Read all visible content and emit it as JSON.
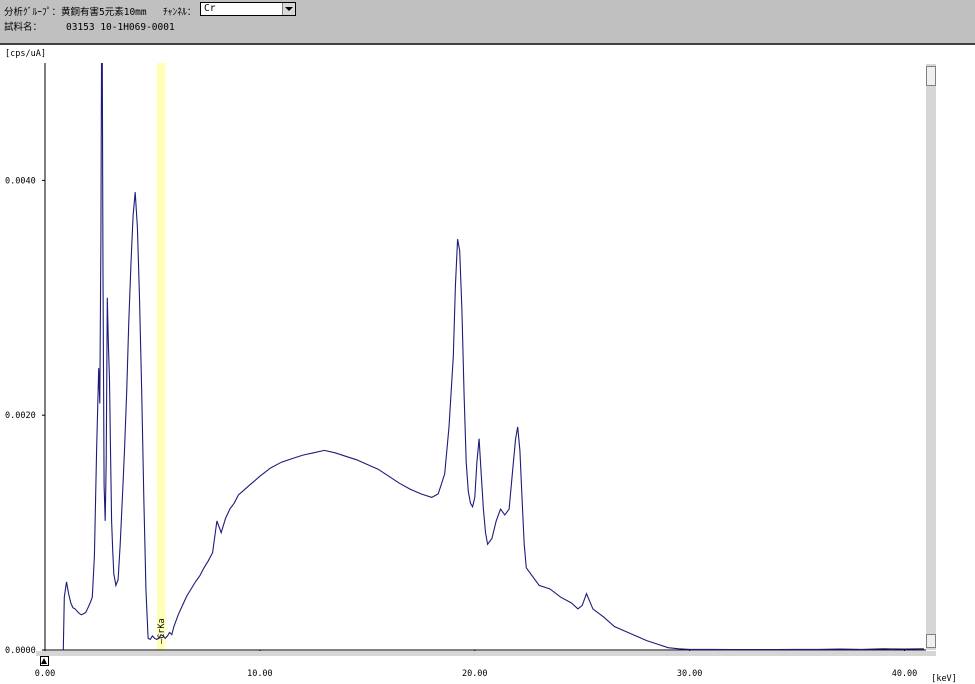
{
  "header": {
    "group_label": "分析ｸﾞﾙｰﾌﾟ：",
    "group_value": "黄銅有害5元素10mm",
    "channel_label": "ﾁｬﾝﾈﾙ：",
    "channel_value": "Cr",
    "sample_label": "試料名：",
    "sample_value": "03153 10-1H069-0001"
  },
  "colors": {
    "spectrum": "#1c1c7a",
    "highlight": "#ffffb8",
    "header_bg": "#c0c0c0",
    "scrollbar": "#d6d6d6"
  },
  "chart_data": {
    "type": "line",
    "xlabel": "[keV]",
    "ylabel": "[cps/uA]",
    "xlim": [
      0,
      41
    ],
    "ylim": [
      0,
      0.005
    ],
    "x_ticks": [
      "0.00",
      "10.00",
      "20.00",
      "30.00",
      "40.00"
    ],
    "y_ticks": [
      "0.0000",
      "0.0020",
      "0.0040"
    ],
    "x_tick_values": [
      0,
      10,
      20,
      30,
      40
    ],
    "y_tick_values": [
      0,
      0.002,
      0.004
    ],
    "grid": false,
    "highlight_band": {
      "label": "CrKa",
      "center": 5.41,
      "width": 0.4
    },
    "series": [
      {
        "x": [
          0.85,
          0.9,
          1.0,
          1.1,
          1.2,
          1.3,
          1.4,
          1.5,
          1.6,
          1.7,
          1.8,
          1.9,
          2.0,
          2.1,
          2.2,
          2.3,
          2.4,
          2.5,
          2.55,
          2.6,
          2.65,
          2.7,
          2.75,
          2.8,
          2.85,
          2.9,
          2.95,
          3.0,
          3.05,
          3.1,
          3.15,
          3.2,
          3.3,
          3.4,
          3.5,
          3.6,
          3.7,
          3.8,
          3.9,
          4.0,
          4.1,
          4.2,
          4.3,
          4.4,
          4.5,
          4.6,
          4.7,
          4.8,
          4.9,
          5.0,
          5.1,
          5.2,
          5.3,
          5.4,
          5.5,
          5.6,
          5.7,
          5.8,
          5.9,
          6.0,
          6.2,
          6.4,
          6.6,
          6.8,
          7.0,
          7.2,
          7.4,
          7.6,
          7.8,
          8.0,
          8.2,
          8.4,
          8.6,
          8.8,
          9.0,
          9.5,
          10.0,
          10.5,
          11.0,
          11.5,
          12.0,
          12.5,
          13.0,
          13.5,
          14.0,
          14.5,
          15.0,
          15.5,
          16.0,
          16.5,
          17.0,
          17.5,
          18.0,
          18.3,
          18.6,
          18.8,
          19.0,
          19.1,
          19.2,
          19.3,
          19.4,
          19.5,
          19.6,
          19.7,
          19.8,
          19.9,
          20.0,
          20.1,
          20.2,
          20.3,
          20.4,
          20.5,
          20.6,
          20.8,
          21.0,
          21.2,
          21.4,
          21.6,
          21.8,
          21.9,
          22.0,
          22.1,
          22.2,
          22.3,
          22.4,
          22.6,
          22.8,
          23.0,
          23.5,
          24.0,
          24.5,
          24.8,
          25.0,
          25.2,
          25.5,
          26.0,
          26.5,
          27.0,
          27.5,
          28.0,
          28.5,
          29.0,
          29.5,
          30.0,
          31.0,
          32.0,
          33.0,
          34.0,
          35.0,
          36.0,
          37.0,
          38.0,
          39.0,
          40.0,
          40.9
        ],
        "y": [
          0,
          0.00045,
          0.00058,
          0.00048,
          0.0004,
          0.00036,
          0.00035,
          0.00033,
          0.00031,
          0.0003,
          0.00031,
          0.00032,
          0.00036,
          0.0004,
          0.00045,
          0.0008,
          0.0017,
          0.0024,
          0.0021,
          0.0035,
          0.006,
          0.0032,
          0.0014,
          0.0011,
          0.0016,
          0.003,
          0.0026,
          0.0023,
          0.0017,
          0.0011,
          0.00085,
          0.00065,
          0.00055,
          0.0006,
          0.0009,
          0.0013,
          0.0017,
          0.0022,
          0.0028,
          0.0033,
          0.0037,
          0.0039,
          0.0036,
          0.003,
          0.0022,
          0.0013,
          0.0005,
          0.0001,
          9e-05,
          0.00012,
          0.0001,
          9e-05,
          0.0001,
          0.00013,
          0.00012,
          0.0001,
          0.00012,
          0.00015,
          0.00013,
          0.0002,
          0.0003,
          0.00038,
          0.00046,
          0.00052,
          0.00058,
          0.00063,
          0.0007,
          0.00076,
          0.00083,
          0.0011,
          0.001,
          0.00112,
          0.0012,
          0.00125,
          0.00132,
          0.0014,
          0.00148,
          0.00155,
          0.0016,
          0.00163,
          0.00166,
          0.00168,
          0.0017,
          0.00168,
          0.00165,
          0.00162,
          0.00158,
          0.00154,
          0.00148,
          0.00142,
          0.00137,
          0.00133,
          0.0013,
          0.00133,
          0.0015,
          0.0019,
          0.0025,
          0.0031,
          0.0035,
          0.0034,
          0.0029,
          0.0022,
          0.0016,
          0.00135,
          0.00125,
          0.00122,
          0.0013,
          0.0016,
          0.0018,
          0.0015,
          0.0012,
          0.001,
          0.0009,
          0.00095,
          0.0011,
          0.0012,
          0.00115,
          0.0012,
          0.0016,
          0.0018,
          0.0019,
          0.0017,
          0.0013,
          0.0009,
          0.0007,
          0.00065,
          0.0006,
          0.00055,
          0.00052,
          0.00045,
          0.0004,
          0.00035,
          0.00038,
          0.00048,
          0.00035,
          0.00028,
          0.0002,
          0.00016,
          0.00012,
          8e-05,
          5e-05,
          2e-05,
          1e-05,
          5e-06,
          5e-06,
          3e-06,
          3e-06,
          3e-06,
          5e-06,
          5e-06,
          8e-06,
          5e-06,
          1e-05,
          8e-06,
          1e-05
        ]
      }
    ]
  }
}
